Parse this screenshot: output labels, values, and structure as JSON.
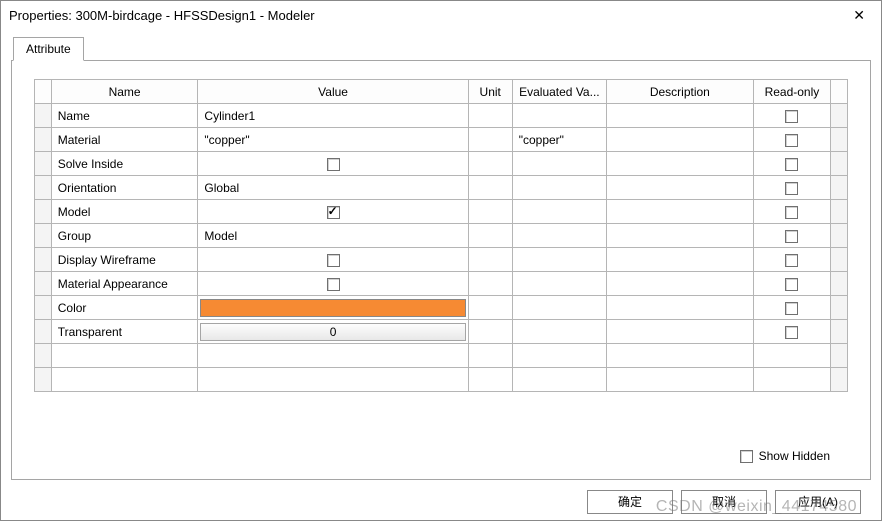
{
  "window": {
    "title": "Properties: 300M-birdcage - HFSSDesign1 - Modeler"
  },
  "tab": {
    "label": "Attribute"
  },
  "headers": {
    "name": "Name",
    "value": "Value",
    "unit": "Unit",
    "evaluated": "Evaluated Va...",
    "description": "Description",
    "readonly": "Read-only"
  },
  "rows": [
    {
      "name": "Name",
      "value_text": "Cylinder1",
      "type": "text",
      "evaluated": "",
      "readonly": false
    },
    {
      "name": "Material",
      "value_text": "\"copper\"",
      "type": "text",
      "evaluated": "\"copper\"",
      "readonly": false
    },
    {
      "name": "Solve Inside",
      "type": "checkbox",
      "checked": false,
      "evaluated": "",
      "readonly": false
    },
    {
      "name": "Orientation",
      "value_text": "Global",
      "type": "text",
      "evaluated": "",
      "readonly": false
    },
    {
      "name": "Model",
      "type": "checkbox",
      "checked": true,
      "evaluated": "",
      "readonly": false
    },
    {
      "name": "Group",
      "value_text": "Model",
      "type": "text",
      "evaluated": "",
      "readonly": false
    },
    {
      "name": "Display Wireframe",
      "type": "checkbox",
      "checked": false,
      "evaluated": "",
      "readonly": false
    },
    {
      "name": "Material Appearance",
      "type": "checkbox",
      "checked": false,
      "evaluated": "",
      "readonly": false
    },
    {
      "name": "Color",
      "type": "color",
      "color": "#f68a33",
      "evaluated": "",
      "readonly": false
    },
    {
      "name": "Transparent",
      "type": "button",
      "value_text": "0",
      "evaluated": "",
      "readonly": false
    }
  ],
  "blank_rows": 2,
  "show_hidden": {
    "label": "Show Hidden",
    "checked": false
  },
  "buttons": {
    "ok": "确定",
    "cancel": "取消",
    "apply": "应用(A)"
  },
  "watermark": "CSDN @weixin_44174580"
}
